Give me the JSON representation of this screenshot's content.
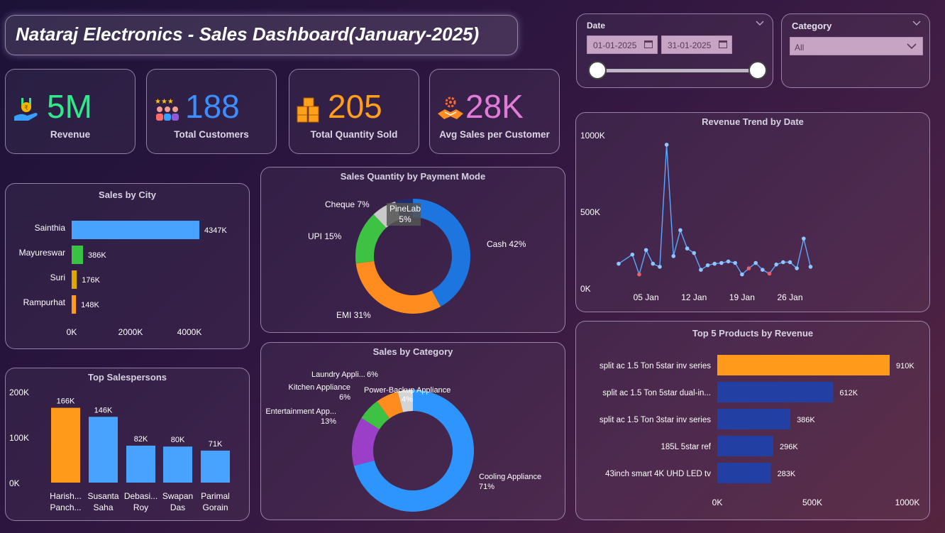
{
  "title": "Nataraj Electronics - Sales Dashboard(January-2025)",
  "kpis": [
    {
      "value": "5M",
      "label": "Revenue",
      "color": "#31e88a",
      "icon": "money-hand-icon"
    },
    {
      "value": "188",
      "label": "Total Customers",
      "color": "#3c8eff",
      "icon": "customers-stars-icon"
    },
    {
      "value": "205",
      "label": "Total Quantity Sold",
      "color": "#ff9f1a",
      "icon": "boxes-icon"
    },
    {
      "value": "28K",
      "label": "Avg Sales per Customer",
      "color": "#e07cd7",
      "icon": "handshake-gear-icon"
    }
  ],
  "filters": {
    "date": {
      "label": "Date",
      "start": "01-01-2025",
      "end": "31-01-2025"
    },
    "category": {
      "label": "Category",
      "value": "All"
    }
  },
  "charts": {
    "city": {
      "title": "Sales by City"
    },
    "payment": {
      "title": "Sales Quantity by Payment Mode"
    },
    "category": {
      "title": "Sales by Category"
    },
    "salespersons": {
      "title": "Top Salespersons"
    },
    "trend": {
      "title": "Revenue Trend by Date"
    },
    "products": {
      "title": "Top 5 Products by Revenue"
    }
  },
  "chart_data": [
    {
      "id": "city",
      "type": "bar",
      "orientation": "horizontal",
      "categories": [
        "Sainthia",
        "Mayureswar",
        "Suri",
        "Rampurhat"
      ],
      "values": [
        4347,
        386,
        176,
        148
      ],
      "labels": [
        "4347K",
        "386K",
        "176K",
        "148K"
      ],
      "colors": [
        "#47a3ff",
        "#39c244",
        "#e0a600",
        "#ff9a1a"
      ],
      "x_ticks": [
        "0K",
        "2000K",
        "4000K"
      ],
      "xlim": [
        0,
        5000
      ],
      "unit": "K"
    },
    {
      "id": "payment",
      "type": "pie",
      "donut": true,
      "slices": [
        {
          "name": "Cash",
          "value": 42,
          "label": "Cash 42%",
          "color": "#1d76e0"
        },
        {
          "name": "EMI",
          "value": 31,
          "label": "EMI 31%",
          "color": "#ff8c1f"
        },
        {
          "name": "UPI",
          "value": 15,
          "label": "UPI 15%",
          "color": "#3dc244"
        },
        {
          "name": "Cheque",
          "value": 7,
          "label": "Cheque 7%",
          "color": "#c9c9c9"
        },
        {
          "name": "PineLab",
          "value": 5,
          "label": "PineLab 5%",
          "color": "#1f2d6e"
        }
      ]
    },
    {
      "id": "category",
      "type": "pie",
      "donut": true,
      "slices": [
        {
          "name": "Cooling Appliance",
          "value": 71,
          "label": "Cooling Appliance 71%",
          "color": "#2e95ff"
        },
        {
          "name": "Entertainment App...",
          "value": 13,
          "label": "Entertainment App... 13%",
          "color": "#9b3fc8"
        },
        {
          "name": "Kitchen Appliance",
          "value": 6,
          "label": "Kitchen Appliance 6%",
          "color": "#3dc244"
        },
        {
          "name": "Laundry Appli...",
          "value": 6,
          "label": "Laundry Appli... 6%",
          "color": "#ff8c1f"
        },
        {
          "name": "Power-Backup Appliance",
          "value": 4,
          "label": "Power-Backup Appliance 4%",
          "color": "#d4d4d4"
        }
      ]
    },
    {
      "id": "salespersons",
      "type": "bar",
      "categories": [
        "Harish... Panch...",
        "Susanta Saha",
        "Debasi... Roy",
        "Swapan Das",
        "Parimal Gorain"
      ],
      "values": [
        166,
        146,
        82,
        80,
        71
      ],
      "labels": [
        "166K",
        "146K",
        "82K",
        "80K",
        "71K"
      ],
      "colors": [
        "#ff9a1a",
        "#47a3ff",
        "#47a3ff",
        "#47a3ff",
        "#47a3ff"
      ],
      "y_ticks": [
        "200K",
        "100K",
        "0K"
      ],
      "ylim": [
        0,
        200
      ],
      "unit": "K"
    },
    {
      "id": "trend",
      "type": "line",
      "x_ticks": [
        "05 Jan",
        "12 Jan",
        "19 Jan",
        "26 Jan"
      ],
      "x_tick_days": [
        5,
        12,
        19,
        26
      ],
      "x_days": [
        1,
        3,
        4,
        5,
        6,
        7,
        8,
        9,
        10,
        11,
        12,
        13,
        14,
        15,
        16,
        17,
        18,
        19,
        20,
        21,
        22,
        23,
        24,
        25,
        26,
        27,
        28,
        29,
        30,
        31
      ],
      "values": [
        160,
        220,
        90,
        250,
        160,
        140,
        940,
        210,
        380,
        260,
        230,
        120,
        150,
        160,
        165,
        175,
        165,
        90,
        130,
        165,
        120,
        95,
        155,
        170,
        170,
        130,
        325,
        140
      ],
      "low_points_days": [
        4,
        20,
        23
      ],
      "y_ticks": [
        "1000K",
        "500K",
        "0K"
      ],
      "ylim": [
        0,
        1000
      ],
      "unit": "K",
      "color": "#5aa8ff"
    },
    {
      "id": "products",
      "type": "bar",
      "orientation": "horizontal",
      "categories": [
        "split ac 1.5 Ton 5star inv series",
        "split ac 1.5 Ton 5star dual-in...",
        "split ac 1.5 Ton 3star inv series",
        "185L 5star ref",
        "43inch smart 4K UHD LED tv"
      ],
      "values": [
        910,
        612,
        386,
        296,
        283
      ],
      "labels": [
        "910K",
        "612K",
        "386K",
        "296K",
        "283K"
      ],
      "colors": [
        "#ff9a1a",
        "#2240a3",
        "#2240a3",
        "#2240a3",
        "#2240a3"
      ],
      "x_ticks": [
        "0K",
        "500K",
        "1000K"
      ],
      "xlim": [
        0,
        1000
      ],
      "unit": "K"
    }
  ]
}
